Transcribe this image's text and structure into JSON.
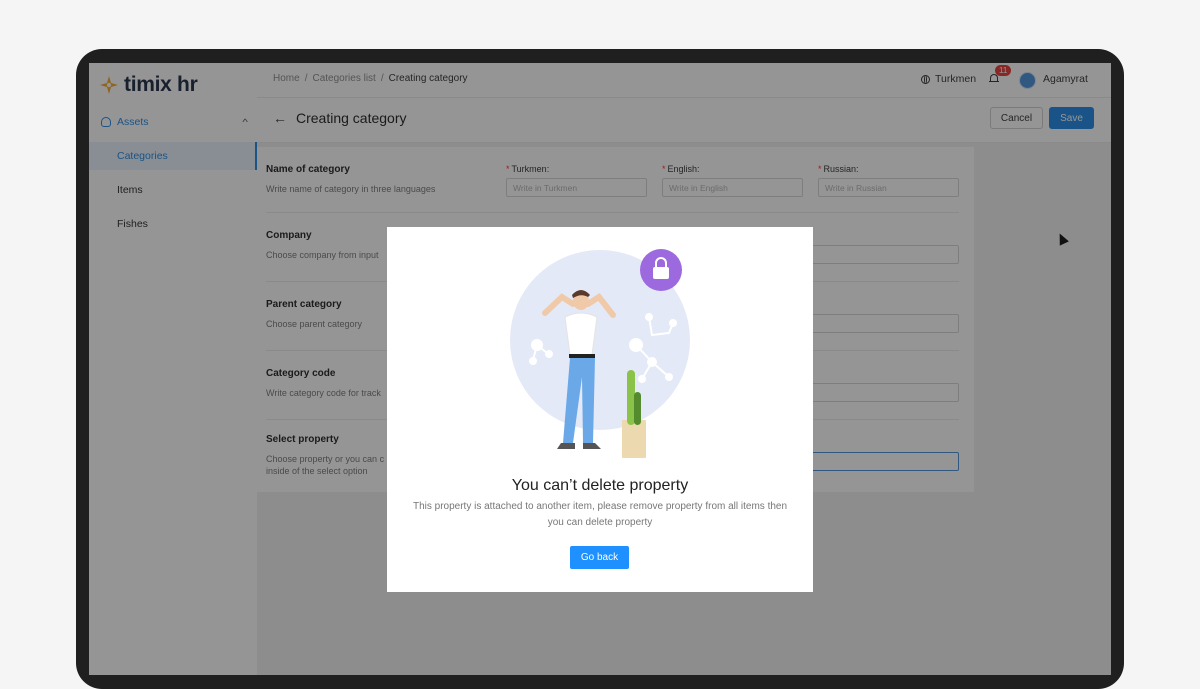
{
  "app": {
    "name": "timix hr",
    "brand_color": "#f5a623",
    "accent_color": "#1e88e5"
  },
  "sidebar": {
    "group": {
      "label": "Assets",
      "icon": "assets-icon"
    },
    "items": [
      {
        "label": "Categories",
        "active": true
      },
      {
        "label": "Items",
        "active": false
      },
      {
        "label": "Fishes",
        "active": false
      }
    ]
  },
  "topbar": {
    "breadcrumb": [
      "Home",
      "Categories list",
      "Creating category"
    ],
    "language": "Turkmen",
    "notifications_count": "11",
    "user_name": "Agamyrat"
  },
  "page": {
    "title": "Creating category",
    "cancel_label": "Cancel",
    "save_label": "Save"
  },
  "form": {
    "name": {
      "title": "Name of category",
      "description": "Write name of category in three languages",
      "fields": [
        {
          "label": "Turkmen:",
          "placeholder": "Write in Turkmen"
        },
        {
          "label": "English:",
          "placeholder": "Write in English"
        },
        {
          "label": "Russian:",
          "placeholder": "Write in Russian"
        }
      ]
    },
    "company": {
      "title": "Company",
      "description": "Choose company from input"
    },
    "parent": {
      "title": "Parent category",
      "description": "Choose parent category"
    },
    "code": {
      "title": "Category code",
      "description": "Write category code for track"
    },
    "property": {
      "title": "Select property",
      "description": "Choose property or you can c inside of the select option"
    }
  },
  "modal": {
    "title": "You can’t delete property",
    "text": "This property is attached to another item, please remove property from all items then you can delete property",
    "button": "Go back"
  }
}
